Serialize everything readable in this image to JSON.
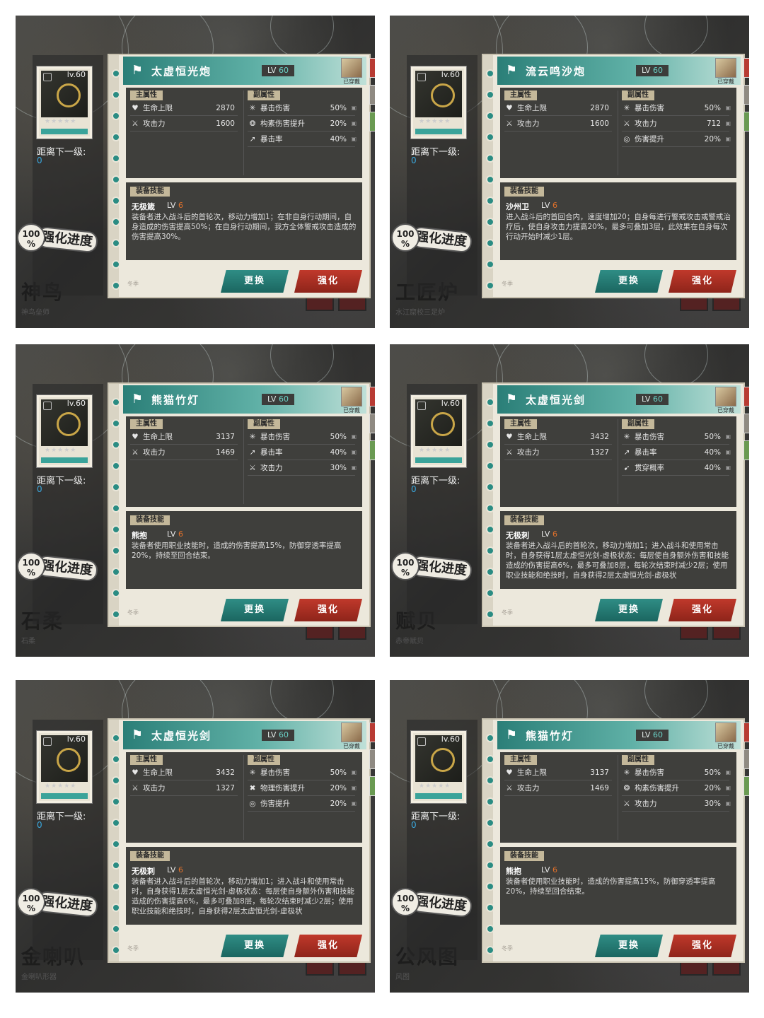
{
  "labels": {
    "main_attr": "主属性",
    "sub_attr": "副属性",
    "skill_header": "装备技能",
    "dist_label": "距离下一级:",
    "worn": "已穿戴",
    "swap": "更换",
    "upgrade": "强化",
    "enhance_label": "强化进度",
    "percent_sign": "%",
    "footer_text": "冬季",
    "lvl_prefix": "LV"
  },
  "panels": [
    {
      "item_level": "lv.60",
      "name": "太虚恒光炮",
      "lv": "60",
      "dist_value": "0",
      "progress": "100",
      "main": [
        {
          "icon": "heart-icon",
          "label": "生命上限",
          "value": "2870"
        },
        {
          "icon": "crossed-swords-icon",
          "label": "攻击力",
          "value": "1600"
        }
      ],
      "sub": [
        {
          "icon": "crit-damage-icon",
          "label": "暴击伤害",
          "value": "50%"
        },
        {
          "icon": "element-damage-icon",
          "label": "构素伤害提升",
          "value": "20%"
        },
        {
          "icon": "crit-rate-icon",
          "label": "暴击率",
          "value": "40%"
        }
      ],
      "skill": {
        "name": "无极箴",
        "lv": "6",
        "desc": "装备者进入战斗后的首轮次，移动力增加1；在非自身行动期间，自身造成的伤害提高50%；在自身行动期间，我方全体警戒攻击造成的伤害提高30%。"
      },
      "bg_title": "神鸟",
      "bg_sub": "神鸟垒师"
    },
    {
      "item_level": "lv.60",
      "name": "流云鸣沙炮",
      "lv": "60",
      "dist_value": "0",
      "progress": "100",
      "main": [
        {
          "icon": "heart-icon",
          "label": "生命上限",
          "value": "2870"
        },
        {
          "icon": "crossed-swords-icon",
          "label": "攻击力",
          "value": "1600"
        }
      ],
      "sub": [
        {
          "icon": "crit-damage-icon",
          "label": "暴击伤害",
          "value": "50%"
        },
        {
          "icon": "crossed-swords-icon",
          "label": "攻击力",
          "value": "712"
        },
        {
          "icon": "damage-boost-icon",
          "label": "伤害提升",
          "value": "20%"
        }
      ],
      "skill": {
        "name": "沙州卫",
        "lv": "6",
        "desc": "进入战斗后的首回合内，速度增加20；自身每进行警戒攻击或警戒治疗后，使自身攻击力提高20%，最多可叠加3层，此效果在自身每次行动开始时减少1层。"
      },
      "bg_title": "工匠炉",
      "bg_sub": "水江窟校三足炉"
    },
    {
      "item_level": "lv.60",
      "name": "熊猫竹灯",
      "lv": "60",
      "dist_value": "0",
      "progress": "100",
      "main": [
        {
          "icon": "heart-icon",
          "label": "生命上限",
          "value": "3137"
        },
        {
          "icon": "crossed-swords-icon",
          "label": "攻击力",
          "value": "1469"
        }
      ],
      "sub": [
        {
          "icon": "crit-damage-icon",
          "label": "暴击伤害",
          "value": "50%"
        },
        {
          "icon": "crit-rate-icon",
          "label": "暴击率",
          "value": "40%"
        },
        {
          "icon": "crossed-swords-icon",
          "label": "攻击力",
          "value": "30%"
        }
      ],
      "skill": {
        "name": "熊抱",
        "lv": "6",
        "desc": "装备者使用职业技能时，造成的伤害提高15%，防御穿透率提高20%，持续至回合结束。"
      },
      "bg_title": "石柔",
      "bg_sub": "石柔"
    },
    {
      "item_level": "lv.60",
      "name": "太虚恒光剑",
      "lv": "60",
      "dist_value": "0",
      "progress": "100",
      "main": [
        {
          "icon": "heart-icon",
          "label": "生命上限",
          "value": "3432"
        },
        {
          "icon": "crossed-swords-icon",
          "label": "攻击力",
          "value": "1327"
        }
      ],
      "sub": [
        {
          "icon": "crit-damage-icon",
          "label": "暴击伤害",
          "value": "50%"
        },
        {
          "icon": "crit-rate-icon",
          "label": "暴击率",
          "value": "40%"
        },
        {
          "icon": "pierce-icon",
          "label": "贯穿概率",
          "value": "40%"
        }
      ],
      "skill": {
        "name": "无极刺",
        "lv": "6",
        "desc": "装备者进入战斗后的首轮次，移动力增加1；进入战斗和使用常击时，自身获得1层太虚恒光剑-虚极状态：每层使自身额外伤害和技能造成的伤害提高6%，最多可叠加8层，每轮次结束时减少2层；使用职业技能和绝技时，自身获得2层太虚恒光剑-虚极状"
      },
      "bg_title": "赋贝",
      "bg_sub": "赤帝赋贝"
    },
    {
      "item_level": "lv.60",
      "name": "太虚恒光剑",
      "lv": "60",
      "dist_value": "0",
      "progress": "100",
      "main": [
        {
          "icon": "heart-icon",
          "label": "生命上限",
          "value": "3432"
        },
        {
          "icon": "crossed-swords-icon",
          "label": "攻击力",
          "value": "1327"
        }
      ],
      "sub": [
        {
          "icon": "crit-damage-icon",
          "label": "暴击伤害",
          "value": "50%"
        },
        {
          "icon": "physical-damage-icon",
          "label": "物理伤害提升",
          "value": "20%"
        },
        {
          "icon": "damage-boost-icon",
          "label": "伤害提升",
          "value": "20%"
        }
      ],
      "skill": {
        "name": "无极刺",
        "lv": "6",
        "desc": "装备者进入战斗后的首轮次，移动力增加1；进入战斗和使用常击时，自身获得1层太虚恒光剑-虚极状态：每层使自身额外伤害和技能造成的伤害提高6%，最多可叠加8层，每轮次结束时减少2层；使用职业技能和绝技时，自身获得2层太虚恒光剑-虚极状"
      },
      "bg_title": "金喇叭",
      "bg_sub": "金喇叭形器"
    },
    {
      "item_level": "lv.60",
      "name": "熊猫竹灯",
      "lv": "60",
      "dist_value": "0",
      "progress": "100",
      "main": [
        {
          "icon": "heart-icon",
          "label": "生命上限",
          "value": "3137"
        },
        {
          "icon": "crossed-swords-icon",
          "label": "攻击力",
          "value": "1469"
        }
      ],
      "sub": [
        {
          "icon": "crit-damage-icon",
          "label": "暴击伤害",
          "value": "50%"
        },
        {
          "icon": "element-damage-icon",
          "label": "构素伤害提升",
          "value": "20%"
        },
        {
          "icon": "crossed-swords-icon",
          "label": "攻击力",
          "value": "30%"
        }
      ],
      "skill": {
        "name": "熊抱",
        "lv": "6",
        "desc": "装备者使用职业技能时，造成的伤害提高15%，防御穿透率提高20%，持续至回合结束。"
      },
      "bg_title": "公风图",
      "bg_sub": "风图"
    }
  ]
}
